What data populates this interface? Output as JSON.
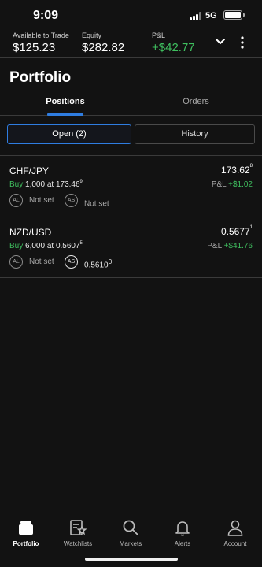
{
  "status_bar": {
    "time": "9:09",
    "network": "5G"
  },
  "account": {
    "available": {
      "label": "Available to Trade",
      "value": "$125.23"
    },
    "equity": {
      "label": "Equity",
      "value": "$282.82"
    },
    "pl": {
      "label": "P&L",
      "value": "+$42.77",
      "color": "#3fbf5f"
    },
    "chevron_icon": "chevron-down-icon",
    "more_icon": "more-vertical-icon"
  },
  "page": {
    "title": "Portfolio"
  },
  "tabs": [
    {
      "label": "Positions",
      "active": true
    },
    {
      "label": "Orders",
      "active": false
    }
  ],
  "segments": [
    {
      "label": "Open (2)",
      "active": true
    },
    {
      "label": "History",
      "active": false
    }
  ],
  "positions": [
    {
      "symbol": "CHF/JPY",
      "price_main": "173.62",
      "price_sup": "8",
      "side": "Buy",
      "qty": "1,000",
      "at": "at",
      "entry_main": "173.46",
      "entry_sup": "9",
      "pl_label": "P&L",
      "pl_value": "+$1.02",
      "al_badge": "AL",
      "al_value": "Not set",
      "as_badge": "AS",
      "as_value_main": "Not set",
      "as_value_sup": ""
    },
    {
      "symbol": "NZD/USD",
      "price_main": "0.5677",
      "price_sup": "1",
      "side": "Buy",
      "qty": "6,000",
      "at": "at",
      "entry_main": "0.5607",
      "entry_sup": "5",
      "pl_label": "P&L",
      "pl_value": "+$41.76",
      "al_badge": "AL",
      "al_value": "Not set",
      "as_badge": "AS",
      "as_value_main": "0.5610",
      "as_value_sup": "0"
    }
  ],
  "bottom_nav": [
    {
      "label": "Portfolio",
      "icon": "portfolio-icon",
      "active": true
    },
    {
      "label": "Watchlists",
      "icon": "watchlist-icon",
      "active": false
    },
    {
      "label": "Markets",
      "icon": "search-icon",
      "active": false
    },
    {
      "label": "Alerts",
      "icon": "bell-icon",
      "active": false
    },
    {
      "label": "Account",
      "icon": "user-icon",
      "active": false
    }
  ]
}
